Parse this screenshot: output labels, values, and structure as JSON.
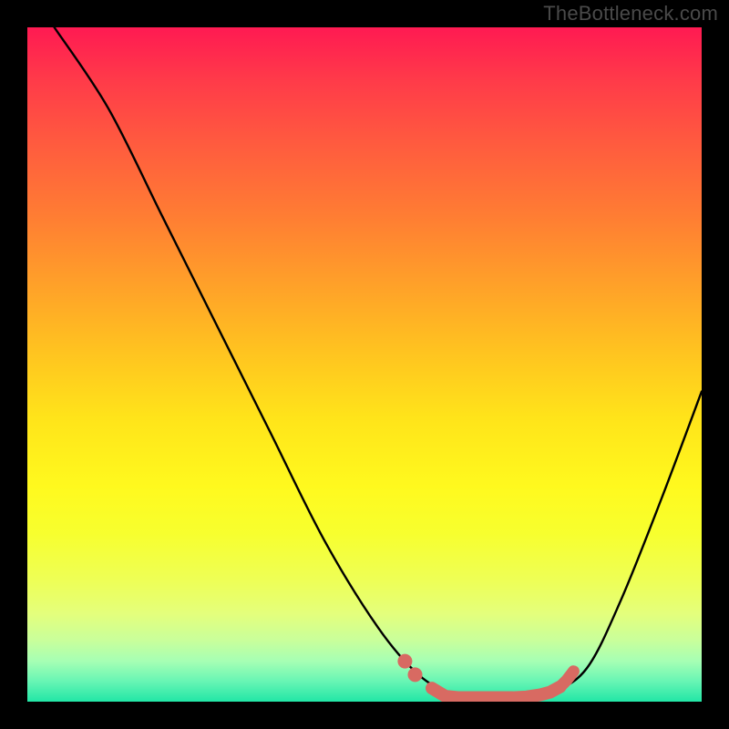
{
  "watermark": "TheBottleneck.com",
  "chart_data": {
    "type": "line",
    "title": "",
    "xlabel": "",
    "ylabel": "",
    "xlim": [
      0,
      100
    ],
    "ylim": [
      0,
      100
    ],
    "series": [
      {
        "name": "bottleneck-curve",
        "color": "#000000",
        "points": [
          {
            "x": 4,
            "y": 100
          },
          {
            "x": 12,
            "y": 88
          },
          {
            "x": 20,
            "y": 72
          },
          {
            "x": 28,
            "y": 56
          },
          {
            "x": 36,
            "y": 40
          },
          {
            "x": 44,
            "y": 24
          },
          {
            "x": 52,
            "y": 11
          },
          {
            "x": 58,
            "y": 4
          },
          {
            "x": 63,
            "y": 1.2
          },
          {
            "x": 68,
            "y": 0.6
          },
          {
            "x": 73,
            "y": 0.6
          },
          {
            "x": 78,
            "y": 1.5
          },
          {
            "x": 83,
            "y": 5
          },
          {
            "x": 88,
            "y": 15
          },
          {
            "x": 94,
            "y": 30
          },
          {
            "x": 100,
            "y": 46
          }
        ]
      },
      {
        "name": "highlight-markers",
        "color": "#d86a62",
        "points": [
          {
            "x": 56,
            "y": 6
          },
          {
            "x": 57.5,
            "y": 4
          },
          {
            "x": 60,
            "y": 2
          },
          {
            "x": 62,
            "y": 0.8
          },
          {
            "x": 64,
            "y": 0.6
          },
          {
            "x": 66,
            "y": 0.6
          },
          {
            "x": 68,
            "y": 0.6
          },
          {
            "x": 70,
            "y": 0.6
          },
          {
            "x": 72,
            "y": 0.6
          },
          {
            "x": 74,
            "y": 0.7
          },
          {
            "x": 76,
            "y": 1.0
          },
          {
            "x": 77.5,
            "y": 1.4
          },
          {
            "x": 79,
            "y": 2.2
          },
          {
            "x": 80,
            "y": 3.2
          },
          {
            "x": 81,
            "y": 4.5
          }
        ]
      }
    ],
    "background_gradient": {
      "top": "#ff1a52",
      "bottom": "#22e6a6",
      "description": "red-yellow-green vertical gradient"
    }
  }
}
